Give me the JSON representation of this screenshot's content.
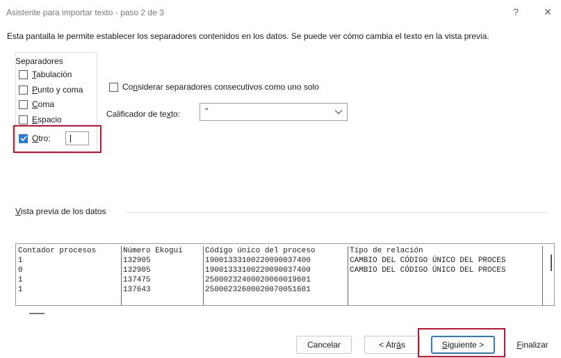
{
  "window": {
    "title": "Asistente para importar texto - paso 2 de 3",
    "help_glyph": "?",
    "close_glyph": "✕"
  },
  "intro_text": "Esta pantalla le permite establecer los separadores contenidos en los datos. Se puede ver cómo cambia el texto en la vista previa.",
  "separators": {
    "group_title": "Separadores",
    "items": [
      {
        "accel": "T",
        "rest": "abulación",
        "checked": false
      },
      {
        "accel": "P",
        "rest": "unto y coma",
        "checked": false
      },
      {
        "accel": "C",
        "rest": "oma",
        "checked": false
      },
      {
        "accel": "E",
        "rest": "spacio",
        "checked": false
      },
      {
        "accel": "O",
        "rest": "tro:",
        "checked": true
      }
    ],
    "otro_value": ""
  },
  "consecutive": {
    "pre": "Co",
    "accel": "n",
    "post": "siderar separadores consecutivos como uno solo",
    "checked": false
  },
  "qualifier": {
    "label_pre": "Calificador de te",
    "label_accel": "x",
    "label_post": "to:",
    "value": "\""
  },
  "preview": {
    "label_accel": "V",
    "label_rest": "ista previa de los datos",
    "columns": [
      {
        "header": "Contador procesos",
        "cells": [
          "1",
          "0",
          "1",
          "1"
        ]
      },
      {
        "header": "Número Ekogui",
        "cells": [
          "132905",
          "132905",
          "137475",
          "137643"
        ]
      },
      {
        "header": "Código único del proceso",
        "cells": [
          "19001333100220090037400",
          "19001333100220090037400",
          "25000232400020060019601",
          "25000232600020070051601"
        ]
      },
      {
        "header": "Tipo de relación",
        "cells": [
          "CAMBIO DEL CÓDIGO ÚNICO DEL PROCES",
          "CAMBIO DEL CÓDIGO ÚNICO DEL PROCES",
          "",
          ""
        ]
      }
    ]
  },
  "buttons": {
    "cancel": "Cancelar",
    "back_pre": "< Atr",
    "back_accel": "á",
    "back_post": "s",
    "next_accel": "S",
    "next_rest": "iguiente >",
    "finish_accel": "F",
    "finish_rest": "inalizar"
  },
  "colors": {
    "accent": "#2b78d2",
    "highlight": "#c8102e"
  }
}
